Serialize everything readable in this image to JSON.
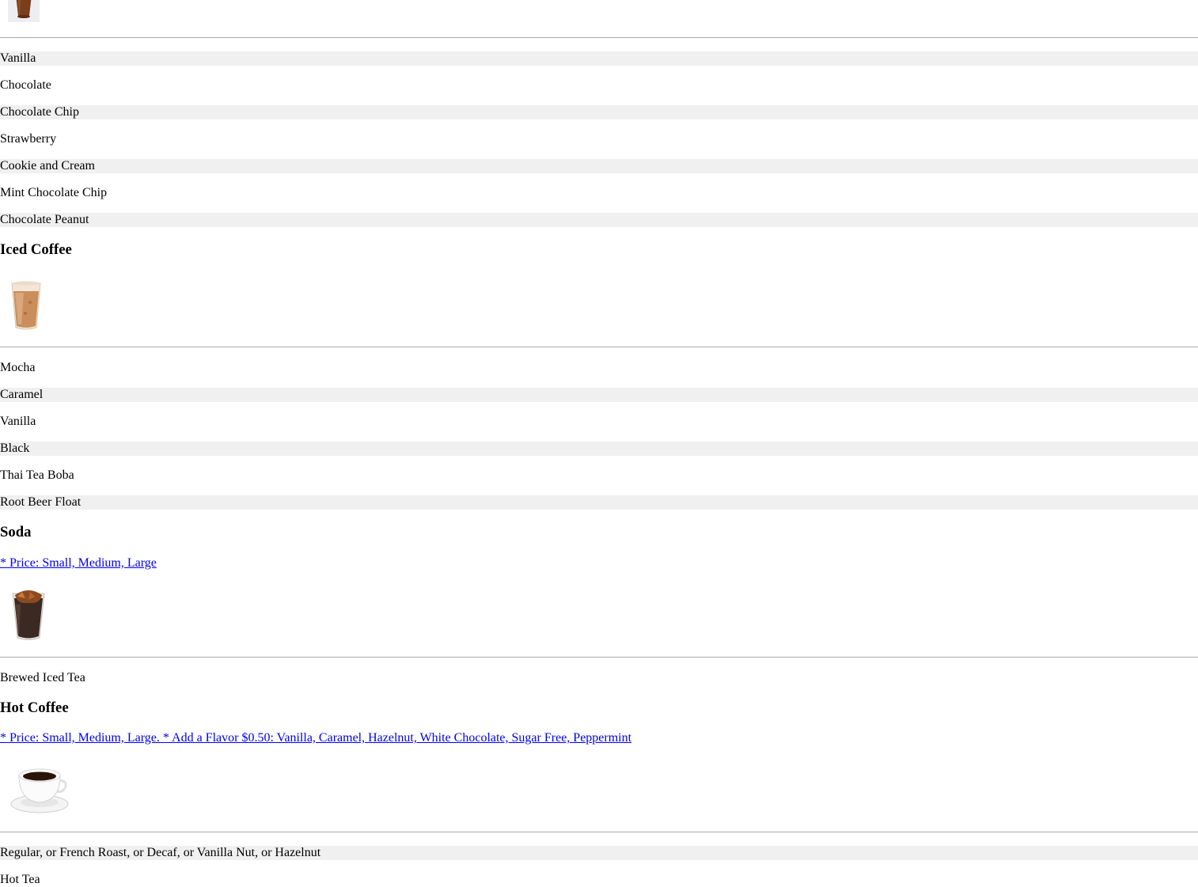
{
  "milkshake": {
    "icon": "milkshake-cup-icon",
    "flavors": [
      "Vanilla",
      "Chocolate",
      "Chocolate Chip",
      "Strawberry",
      "Cookie and Cream",
      "Mint Chocolate Chip",
      "Chocolate Peanut"
    ]
  },
  "iced_coffee": {
    "title": "Iced Coffee",
    "icon": "iced-coffee-cup-icon",
    "items": [
      "Mocha",
      "Caramel",
      "Vanilla",
      "Black",
      "Thai Tea Boba",
      "Root Beer Float"
    ]
  },
  "soda": {
    "title": "Soda",
    "note": "* Price: Small, Medium, Large",
    "icon": "iced-tea-cup-icon",
    "items": [
      "Brewed Iced Tea"
    ]
  },
  "hot_coffee": {
    "title": "Hot Coffee",
    "note": "* Price: Small, Medium, Large. * Add a Flavor $0.50: Vanilla, Caramel, Hazelnut, White Chocolate, Sugar Free, Peppermint",
    "icon": "coffee-cup-saucer-icon",
    "items": [
      "Regular, or French Roast, or Decaf, or Vanilla Nut, or Hazelnut",
      "Hot Tea"
    ]
  },
  "colors": {
    "row_shade": "#f0f0f0",
    "rule": "#a8a8a8",
    "link": "#0000ee"
  }
}
